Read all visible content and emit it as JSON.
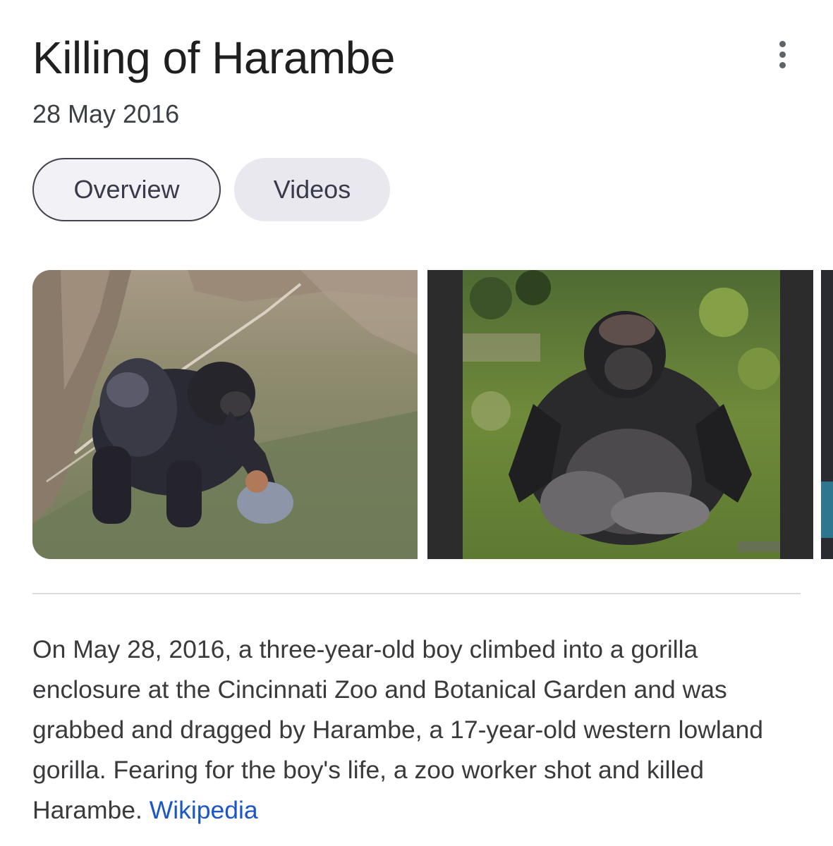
{
  "header": {
    "title": "Killing of Harambe",
    "menu_icon": "more-vert-icon"
  },
  "date": "28 May 2016",
  "tabs": [
    {
      "label": "Overview",
      "selected": true
    },
    {
      "label": "Videos",
      "selected": false
    }
  ],
  "images": [
    {
      "subject": "gorilla in enclosure holding a boy"
    },
    {
      "subject": "gorilla sitting on grass"
    },
    {
      "subject": "partially visible third image"
    }
  ],
  "description": {
    "text": "On May 28, 2016, a three-year-old boy climbed into a gorilla enclosure at the Cincinnati Zoo and Botanical Garden and was grabbed and dragged by Harambe, a 17-year-old western lowland gorilla. Fearing for the boy's life, a zoo worker shot and killed Harambe.",
    "source_label": "Wikipedia"
  },
  "colors": {
    "link": "#1a56c8",
    "chip_selected_border": "#45424f",
    "chip_background": "#e9e8ee"
  }
}
